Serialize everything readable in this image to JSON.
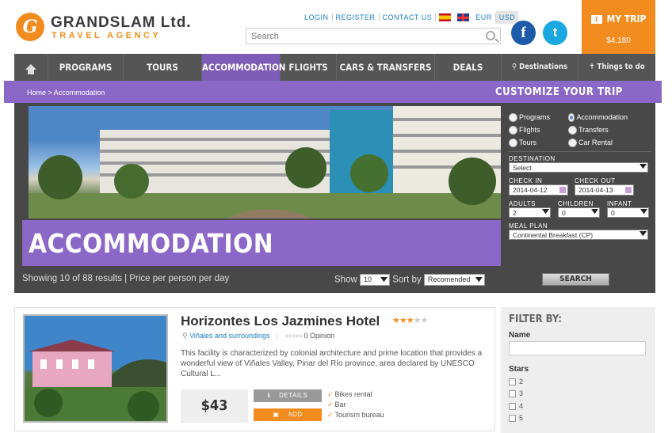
{
  "header": {
    "logo_letter": "G",
    "logo_name": "GRANDSLAM Ltd.",
    "logo_tagline": "TRAVEL AGENCY",
    "links": [
      "LOGIN",
      "REGISTER",
      "CONTACT US"
    ],
    "currencies": [
      "EUR",
      "USD"
    ],
    "search_placeholder": "Search",
    "facebook": "f",
    "twitter": "t"
  },
  "trip": {
    "label": "MY TRIP",
    "badge": "1",
    "amount": "$4,180"
  },
  "nav": {
    "items": [
      "PROGRAMS",
      "TOURS",
      "ACCOMMODATION",
      "FLIGHTS",
      "CARS & TRANSFERS",
      "DEALS"
    ],
    "destinations": "Destinations",
    "things": "Things to do"
  },
  "breadcrumb": "Home > Accommodation",
  "customize": "CUSTOMIZE YOUR TRIP",
  "hero_title": "ACCOMMODATION",
  "results": {
    "text": "Showing 10 of 88 results | Price per person per day",
    "show_label": "Show",
    "show_value": "10",
    "sort_label": "Sort by",
    "sort_value": "Recomended"
  },
  "form": {
    "types": [
      "Programs",
      "Accommodation",
      "Flights",
      "Transfers",
      "Tours",
      "Car Rental"
    ],
    "destination_label": "DESTINATION",
    "destination_value": "Select",
    "checkin_label": "CHECK IN",
    "checkin_value": "2014-04-12",
    "checkout_label": "CHECK OUT",
    "checkout_value": "2014-04-13",
    "adults_label": "ADULTS",
    "adults_value": "2",
    "children_label": "CHILDREN",
    "children_value": "0",
    "infant_label": "INFANT",
    "infant_value": "0",
    "meal_label": "MEAL PLAN",
    "meal_value": "Continental Breakfast (CP)",
    "search_button": "SEARCH"
  },
  "listing": {
    "title": "Horizontes Los Jazmines Hotel",
    "stars_filled": 3,
    "stars_total": 5,
    "location": "Viñales and surroundings",
    "opinion": "0 Opinion",
    "description": "This facility is characterized by colonial architecture and prime location that provides a wonderful view of Viñales Valley, Pinar del Río province, area declared by UNESCO Cultural L...",
    "price": "$43",
    "details_button": "DETAILS",
    "add_button": "ADD",
    "features": [
      "Bikes rental",
      "Bar",
      "Tourism bureau"
    ]
  },
  "filter": {
    "title": "FILTER BY:",
    "name_label": "Name",
    "stars_label": "Stars",
    "stars_options": [
      "2",
      "3",
      "4",
      "5"
    ]
  },
  "colors": {
    "orange": "#f28c1e",
    "purple": "#8b67c7",
    "dark": "#484848"
  }
}
